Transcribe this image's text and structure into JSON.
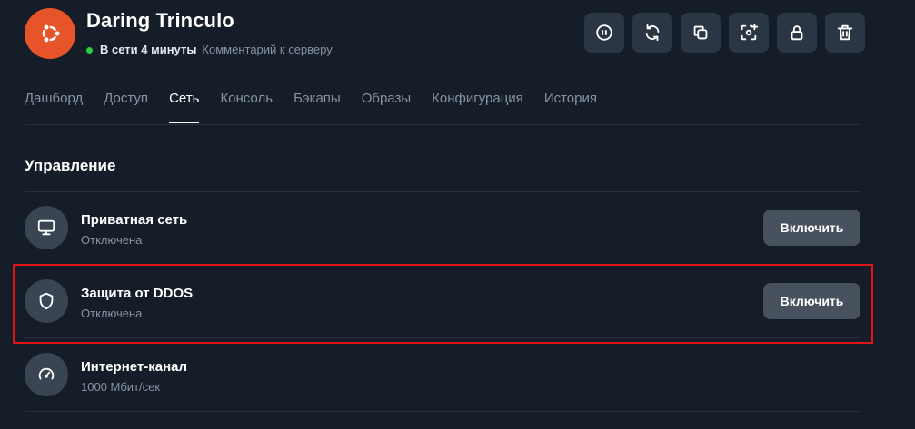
{
  "server": {
    "title": "Daring Trinculo",
    "status": "В сети 4 минуты",
    "comment_link": "Комментарий к серверу",
    "status_color": "#2ecc40",
    "avatar_color": "#e8542a",
    "avatar_icon": "ubuntu-logo"
  },
  "actions": [
    {
      "icon": "pause-icon"
    },
    {
      "icon": "refresh-icon"
    },
    {
      "icon": "copy-icon"
    },
    {
      "icon": "snapshot-icon"
    },
    {
      "icon": "lock-icon"
    },
    {
      "icon": "trash-icon"
    }
  ],
  "tabs": [
    {
      "label": "Дашборд",
      "active": false
    },
    {
      "label": "Доступ",
      "active": false
    },
    {
      "label": "Сеть",
      "active": true
    },
    {
      "label": "Консоль",
      "active": false
    },
    {
      "label": "Бэкапы",
      "active": false
    },
    {
      "label": "Образы",
      "active": false
    },
    {
      "label": "Конфигурация",
      "active": false
    },
    {
      "label": "История",
      "active": false
    }
  ],
  "management": {
    "title": "Управление",
    "rows": [
      {
        "title": "Приватная сеть",
        "subtitle": "Отключена",
        "button": "Включить",
        "icon": "monitor-icon"
      },
      {
        "title": "Защита от DDOS",
        "subtitle": "Отключена",
        "button": "Включить",
        "icon": "shield-icon"
      },
      {
        "title": "Интернет-канал",
        "subtitle": "1000 Мбит/сек",
        "icon": "speedometer-icon"
      }
    ]
  },
  "highlight_color": "#e01616"
}
